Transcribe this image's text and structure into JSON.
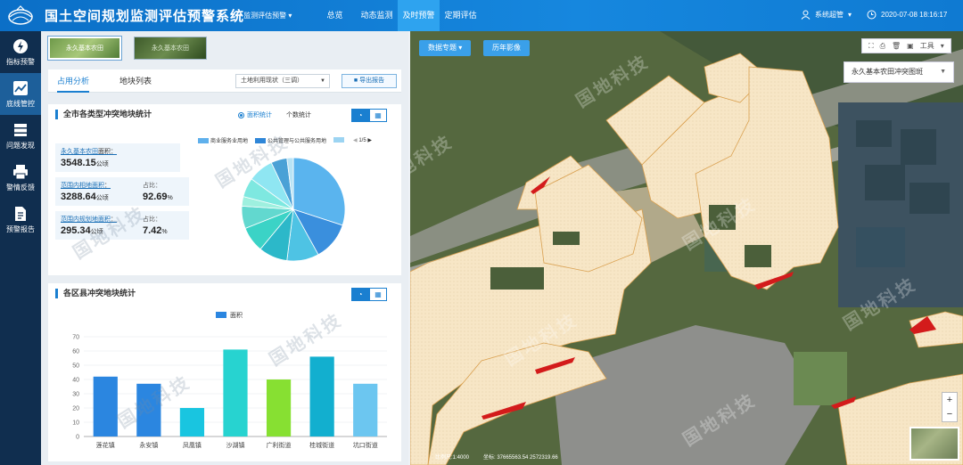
{
  "header": {
    "title": "国土空间规划监测评估预警系统",
    "module_select": "监测评估预警",
    "nav": [
      "总览",
      "动态监测",
      "及时预警",
      "定期评估"
    ],
    "active_nav": 2,
    "user": "系统超管",
    "datetime": "2020-07-08  18:16:17"
  },
  "sidebar": {
    "items": [
      {
        "label": "指标预警",
        "icon": "bolt-icon"
      },
      {
        "label": "底线管控",
        "icon": "trend-chart-icon"
      },
      {
        "label": "问题发现",
        "icon": "list-icon"
      },
      {
        "label": "警情反馈",
        "icon": "printer-icon"
      },
      {
        "label": "预警报告",
        "icon": "document-icon"
      }
    ],
    "active": 1
  },
  "layers": {
    "thumb1": "永久基本农田",
    "thumb2": "永久基本农田"
  },
  "tabs": {
    "items": [
      "占用分析",
      "地块列表"
    ],
    "active": 0,
    "select_value": "土地利用现状（三调）",
    "export_label": "导出报告"
  },
  "stats_card": {
    "title": "全市各类型冲突地块统计",
    "radio_area": "面积统计",
    "radio_count": "个数统计",
    "legend": [
      {
        "name": "商业服务业用地",
        "color": "#5fb0ec"
      },
      {
        "name": "公共管理与公共服务用地",
        "color": "#2f86d8"
      },
      {
        "name": "",
        "color": "#9cd4f2"
      }
    ],
    "legend_page": "1/5",
    "total_label": "永久基本农田",
    "total_tail": "面积：",
    "total_value": "3548.15",
    "total_unit": "公顷",
    "inside_label": "范围内相地面积",
    "inside_tail": "：",
    "inside_value": "3288.64",
    "inside_unit": "公顷",
    "inside_ratio_label": "占比：",
    "inside_ratio": "92.69",
    "outside_label": "范围内规划地面积",
    "outside_tail": "：",
    "outside_value": "295.34",
    "outside_unit": "公顷",
    "outside_ratio_label": "占比：",
    "outside_ratio": "7.42",
    "pct": "%"
  },
  "district_card": {
    "title": "各区县冲突地块统计"
  },
  "chart_data": [
    {
      "type": "pie",
      "values": [
        30,
        12,
        10,
        9,
        8,
        7,
        3,
        6,
        8,
        5,
        2
      ],
      "colors": [
        "#5ab4ee",
        "#3a8fdd",
        "#4ec3e4",
        "#2cb8c9",
        "#3bd3c6",
        "#62d8cf",
        "#9ef0df",
        "#7ee8e0",
        "#8fe6f2",
        "#4aa1d6",
        "#b8e3f5"
      ]
    },
    {
      "type": "bar",
      "categories": [
        "莲花镇",
        "永安镇",
        "凤凰镇",
        "沙湖镇",
        "广利街道",
        "桂城街道",
        "坑口街道"
      ],
      "values": [
        42,
        37,
        20,
        61,
        40,
        56,
        37
      ],
      "colors": [
        "#2b86e0",
        "#2b86e0",
        "#19c5e0",
        "#27d3d0",
        "#87e032",
        "#12afcf",
        "#6cc6f0"
      ],
      "legend": "面积",
      "ylim": [
        0,
        70
      ],
      "yticks": [
        0,
        10,
        20,
        30,
        40,
        50,
        60,
        70
      ]
    }
  ],
  "map": {
    "data_topic_btn": "数据专题",
    "history_btn": "历年影像",
    "layer_select": "永久基本农田冲突图斑",
    "tools_label": "工具",
    "zoom_in": "+",
    "zoom_out": "−",
    "scale_text": "比例尺:1:4000",
    "coord_text": "坐标: 37665563.54 2572319.66"
  },
  "watermark": "国地科技"
}
